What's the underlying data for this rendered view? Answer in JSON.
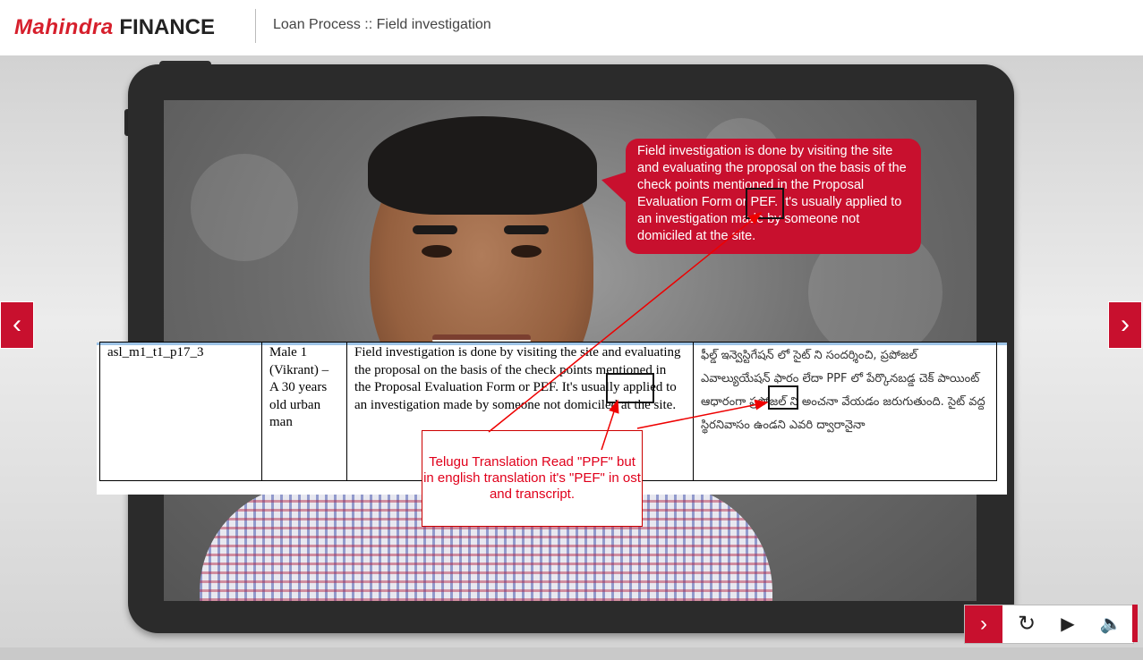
{
  "header": {
    "logo_brand": "Mahindra",
    "logo_finance": "FINANCE",
    "title": "Loan Process :: Field investigation"
  },
  "bubble": {
    "text": "Field investigation is done by visiting the site and evaluating the proposal on the basis of the check points mentioned in the Proposal Evaluation Form or PEF. It's usually applied to an investigation made by someone not domiciled at the site."
  },
  "doc_table": {
    "rows": [
      {
        "id": "asl_m1_t1_p17_3",
        "character": "Male 1 (Vikrant) – A 30 years old urban man",
        "english": "Field investigation is done by visiting the site and evaluating the proposal on the basis of the check points mentioned in the Proposal Evaluation Form or PEF. It's usually applied to an investigation made by someone not domiciled at the site.",
        "telugu": "ఫీల్డ్ ఇన్వెస్టిగేషన్ లో సైట్ ని సందర్శించి, ప్రపోజల్ ఎవాల్యుయేషన్ ఫారం లేదా PPF లో పేర్కొనబడ్డ చెక్ పాయింట్ ఆధారంగా ప్రపోజల్ ని అంచనా వేయడం జరుగుతుంది. సైట్ వద్ద స్థిరనివాసం ఉండని ఎవరి ద్వారానైనా"
      }
    ]
  },
  "annotation": {
    "note": "Telugu Translation Read \"PPF\" but in english translation it's \"PEF\" in ost and transcript."
  },
  "nav": {
    "prev_icon": "chevron-left-icon",
    "next_icon": "chevron-right-icon",
    "prev_glyph": "‹",
    "next_glyph": "›"
  },
  "controls": {
    "next_glyph": "›",
    "replay_glyph": "↻",
    "play_glyph": "▶",
    "audio_glyph": "🔈"
  },
  "colors": {
    "brand_red": "#c8102e",
    "annotation_red": "#e0001b"
  }
}
